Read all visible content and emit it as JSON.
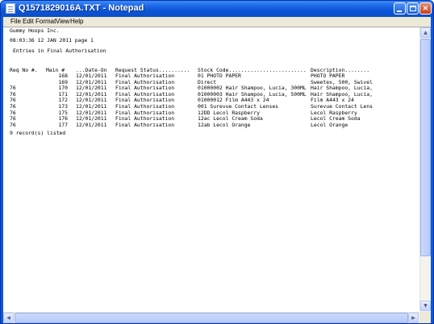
{
  "window": {
    "title": "Q1571829016A.TXT - Notepad",
    "controls": {
      "minimize": "minimize",
      "maximize": "maximize",
      "close": "×"
    }
  },
  "menu": [
    "File",
    "Edit",
    "Format",
    "View",
    "Help"
  ],
  "document": {
    "company": "Gummy Hoops Inc.",
    "header_line": "08:03:36  12 JAN 2011 page    1",
    "report_title": "Entries in Final Authorisation",
    "columns": [
      "Req No #.",
      "Main #",
      "...Date-On",
      "Request Status..........",
      "Stock Code.........................",
      "Description........"
    ],
    "rows": [
      [
        "",
        "168",
        "12/01/2011",
        "Final Authorisation",
        "01 PHOTO PAPER",
        "PHOTO PAPER"
      ],
      [
        "",
        "169",
        "12/01/2011",
        "Final Authorisation",
        "Direct",
        "Sweetex, 500, Swivel"
      ],
      [
        "76",
        "170",
        "12/01/2011",
        "Final Authorisation",
        "01000002 Hair Shampoo, Lucia, 300ML",
        "Hair Shampoo, Lucia,"
      ],
      [
        "76",
        "171",
        "12/01/2011",
        "Final Authorisation",
        "01000003 Hair Shampoo, Lucia, 500ML",
        "Hair Shampoo, Lucia,"
      ],
      [
        "76",
        "172",
        "12/01/2011",
        "Final Authorisation",
        "01000012 Film A443 x 24",
        "Film A443 x 24"
      ],
      [
        "76",
        "173",
        "12/01/2011",
        "Final Authorisation",
        "001 Surevue Contact Lenses",
        "Surevue Contact Lens"
      ],
      [
        "76",
        "175",
        "12/01/2011",
        "Final Authorisation",
        "12DD Lecol Raspberry",
        "Lecol Raspberry"
      ],
      [
        "76",
        "176",
        "12/01/2011",
        "Final Authorisation",
        "12ac Lecol Cream Soda",
        "Lecol Cream Soda"
      ],
      [
        "76",
        "177",
        "12/01/2011",
        "Final Authorisation",
        "12ab Lecol Orange",
        "Lecol Orange"
      ]
    ],
    "footer": "9 record(s) listed"
  },
  "colors": {
    "titlebar": "#0a5ad8",
    "menubar": "#ece9d8",
    "close_button": "#c6401e"
  }
}
